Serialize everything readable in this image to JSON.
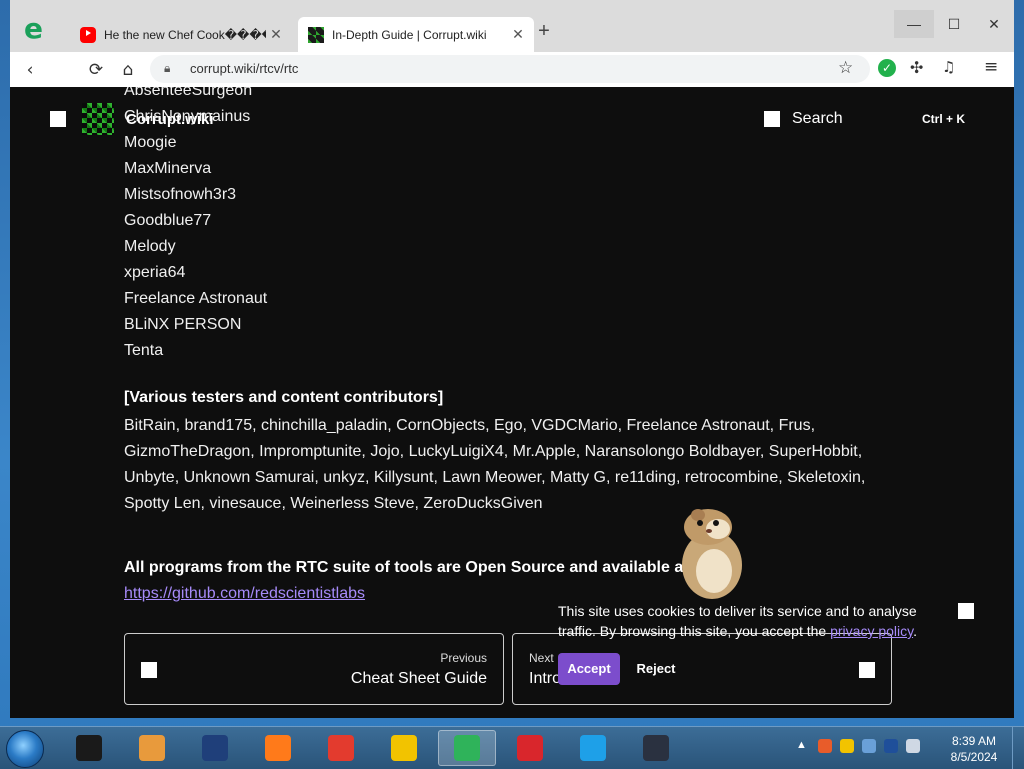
{
  "browser": {
    "tabs": [
      {
        "title": "He the new Chef Cook������",
        "favicon": "youtube-icon",
        "active": false
      },
      {
        "title": "In-Depth Guide | Corrupt.wiki",
        "favicon": "corrupt-wiki-icon",
        "active": true
      }
    ],
    "new_tab": "+",
    "window_controls": {
      "minimize": "—",
      "maximize": "☐",
      "close": "✕"
    },
    "nav": {
      "back": "‹",
      "forward": "›",
      "reload": "⟳",
      "home": "⌂"
    },
    "url": "corrupt.wiki/rtcv/rtc",
    "star": "☆",
    "menu": "≡"
  },
  "site": {
    "name": "Corrupt.wiki",
    "search_label": "Search",
    "search_shortcut": "Ctrl + K"
  },
  "content": {
    "names": [
      "AbsenteeSurgeon",
      "ChrisNonymainus",
      "Moogie",
      "MaxMinerva",
      "Mistsofnowh3r3",
      "Goodblue77",
      "Melody",
      "xperia64",
      "Freelance Astronaut",
      "BLiNX PERSON",
      "Tenta"
    ],
    "testers_title": "[Various testers and content contributors]",
    "testers_lines": [
      "BitRain, brand175, chinchilla_paladin, CornObjects, Ego, VGDCMario, Freelance Astronaut, Frus,",
      "GizmoTheDragon, Impromptunite, Jojo, LuckyLuigiX4, Mr.Apple, Naransolongo Boldbayer, SuperHobbit,",
      "Unbyte, Unknown Samurai, unkyz, Killysunt, Lawn Meower, Matty G, re11ding, retrocombine, Skeletoxin,",
      "Spotty Len, vinesauce, Weinerless Steve, ZeroDucksGiven"
    ],
    "open_source_text": "All programs from the RTC suite of tools are Open Source and available at:",
    "github_link": "https://github.com/redscientistlabs"
  },
  "pager": {
    "prev_small": "Previous",
    "prev_title": "Cheat Sheet Guide",
    "next_small": "Next",
    "next_title": "Intro"
  },
  "cookie": {
    "text_before": "This site uses cookies to deliver its service and to analyse traffic. By browsing this site, you accept the ",
    "link": "privacy policy",
    "text_after": ".",
    "accept": "Accept",
    "reject": "Reject"
  },
  "taskbar": {
    "time": "8:39 AM",
    "date": "8/5/2024",
    "tray_arrow": "▲",
    "apps": [
      {
        "name": "media-app-icon",
        "color": "#1a1a1a"
      },
      {
        "name": "video-player-icon",
        "color": "#e89a3c"
      },
      {
        "name": "globe-app-icon",
        "color": "#1f3f7a"
      },
      {
        "name": "firefox-icon",
        "color": "#ff7a1a"
      },
      {
        "name": "chrome-icon",
        "color": "#e33b2e"
      },
      {
        "name": "plus-app-icon",
        "color": "#f2c300"
      },
      {
        "name": "edge-green-icon",
        "color": "#2fb35a"
      },
      {
        "name": "wps-icon",
        "color": "#d9262c"
      },
      {
        "name": "skype-icon",
        "color": "#1ea0e8"
      },
      {
        "name": "screen-app-icon",
        "color": "#2a3140"
      }
    ]
  }
}
